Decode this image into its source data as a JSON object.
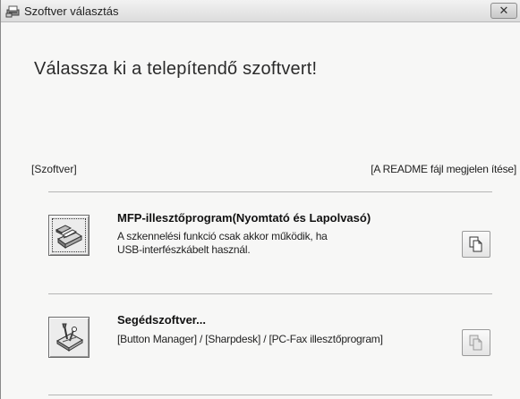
{
  "window": {
    "title": "Szoftver választás",
    "close_glyph": "✕"
  },
  "heading": "Válassza ki a telepítendő szoftvert!",
  "section": {
    "left_label": "[Szoftver]",
    "right_label": "[A README fájl megjelen ítése]"
  },
  "items": [
    {
      "title": "MFP-illesztőprogram(Nyomtató és Lapolvasó)",
      "desc_line1": "A szkennelési funkció csak akkor működik, ha",
      "desc_line2": "USB-interfészkábelt használ.",
      "icon": "printer-scanner-icon",
      "readme_icon": "document-icon",
      "readme_enabled": true
    },
    {
      "title": "Segédszoftver...",
      "desc_line1": "[Button Manager] / [Sharpdesk] / [PC-Fax illesztőprogram]",
      "icon": "tools-software-icon",
      "readme_icon": "document-icon",
      "readme_enabled": false
    }
  ]
}
